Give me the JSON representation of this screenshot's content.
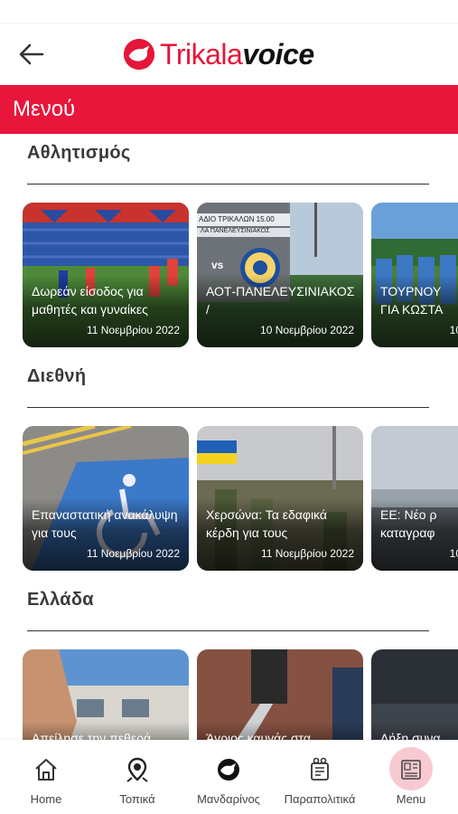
{
  "header": {
    "logo_red": "Trikala",
    "logo_black": "voice"
  },
  "menu": {
    "title": "Μενού"
  },
  "sections": [
    {
      "title": "Αθλητισμός",
      "cards": [
        {
          "title": "Δωρεάν είσοδος για μαθητές και γυναίκες",
          "date": "11 Νοεμβρίου 2022"
        },
        {
          "title": "ΑΟΤ-ΠΑΝΕΛΕΥΣΙΝΙΑΚΟΣ /",
          "date": "10 Νοεμβρίου 2022",
          "badge_line1": "ΑΔΙΟ ΤΡΙΚΑΛΩΝ 15.00",
          "badge_line2": "ΛΑ ΠΑΝΕΛΕΥΣΙΝΙΑΚΟΣ",
          "badge_vs": "vs"
        },
        {
          "title": "ΤΟΥΡΝΟΥ ΓΙΑ ΚΩΣΤΑ",
          "date": "10"
        }
      ]
    },
    {
      "title": "Διεθνή",
      "cards": [
        {
          "title": "Επαναστατική ανακάλυψη για τους",
          "date": "11 Νοεμβρίου 2022"
        },
        {
          "title": "Χερσώνα: Τα εδαφικά κέρδη για τους",
          "date": "11 Νοεμβρίου 2022"
        },
        {
          "title": "ΕΕ: Νέο ρ καταγραφ",
          "date": "10"
        }
      ]
    },
    {
      "title": "Ελλάδα",
      "cards": [
        {
          "title": "Απείλησε την πεθερά",
          "date": ""
        },
        {
          "title": "Άγριος καυγάς στα",
          "date": ""
        },
        {
          "title": "Λήξη συνα",
          "date": ""
        }
      ]
    }
  ],
  "bottom_nav": [
    {
      "label": "Home",
      "icon": "home-icon"
    },
    {
      "label": "Τοπικά",
      "icon": "map-pin-icon"
    },
    {
      "label": "Μανδαρίνος",
      "icon": "mandarin-icon"
    },
    {
      "label": "Παραπολιτικά",
      "icon": "paper-icon"
    },
    {
      "label": "Menu",
      "icon": "menu-grid-icon",
      "active": true
    }
  ],
  "colors": {
    "brand_red": "#e8163b",
    "active_nav_bg": "#f9c9d2"
  }
}
